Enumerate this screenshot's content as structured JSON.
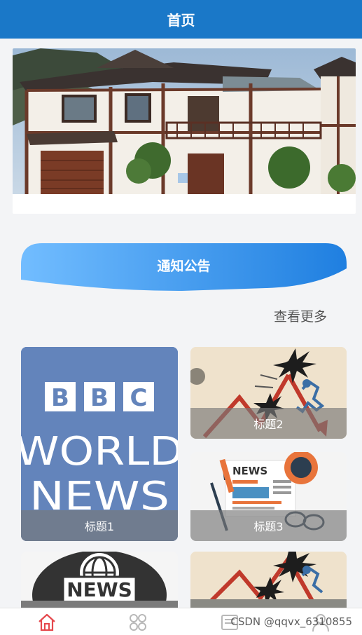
{
  "header": {
    "title": "首页"
  },
  "notice": {
    "title": "通知公告",
    "more_label": "查看更多"
  },
  "cards": [
    {
      "title": "标题1",
      "image": "bbc-world-news"
    },
    {
      "title": "标题2",
      "image": "news-chart-explosion"
    },
    {
      "title": "标题3",
      "image": "newspaper-glasses"
    },
    {
      "title": "",
      "image": "news-globe"
    },
    {
      "title": "",
      "image": "news-chart-explosion"
    }
  ],
  "tabbar": {
    "items": [
      {
        "icon": "home-icon",
        "active": true
      },
      {
        "icon": "grid-icon",
        "active": false
      },
      {
        "icon": "news-icon",
        "active": false
      },
      {
        "icon": "user-icon",
        "active": false
      }
    ]
  },
  "watermark": "CSDN @qqvx_6310855",
  "colors": {
    "primary": "#1a78c8",
    "active_tab": "#e5484d",
    "notice_gradient_start": "#6db8ff",
    "notice_gradient_end": "#1e7fe0"
  }
}
